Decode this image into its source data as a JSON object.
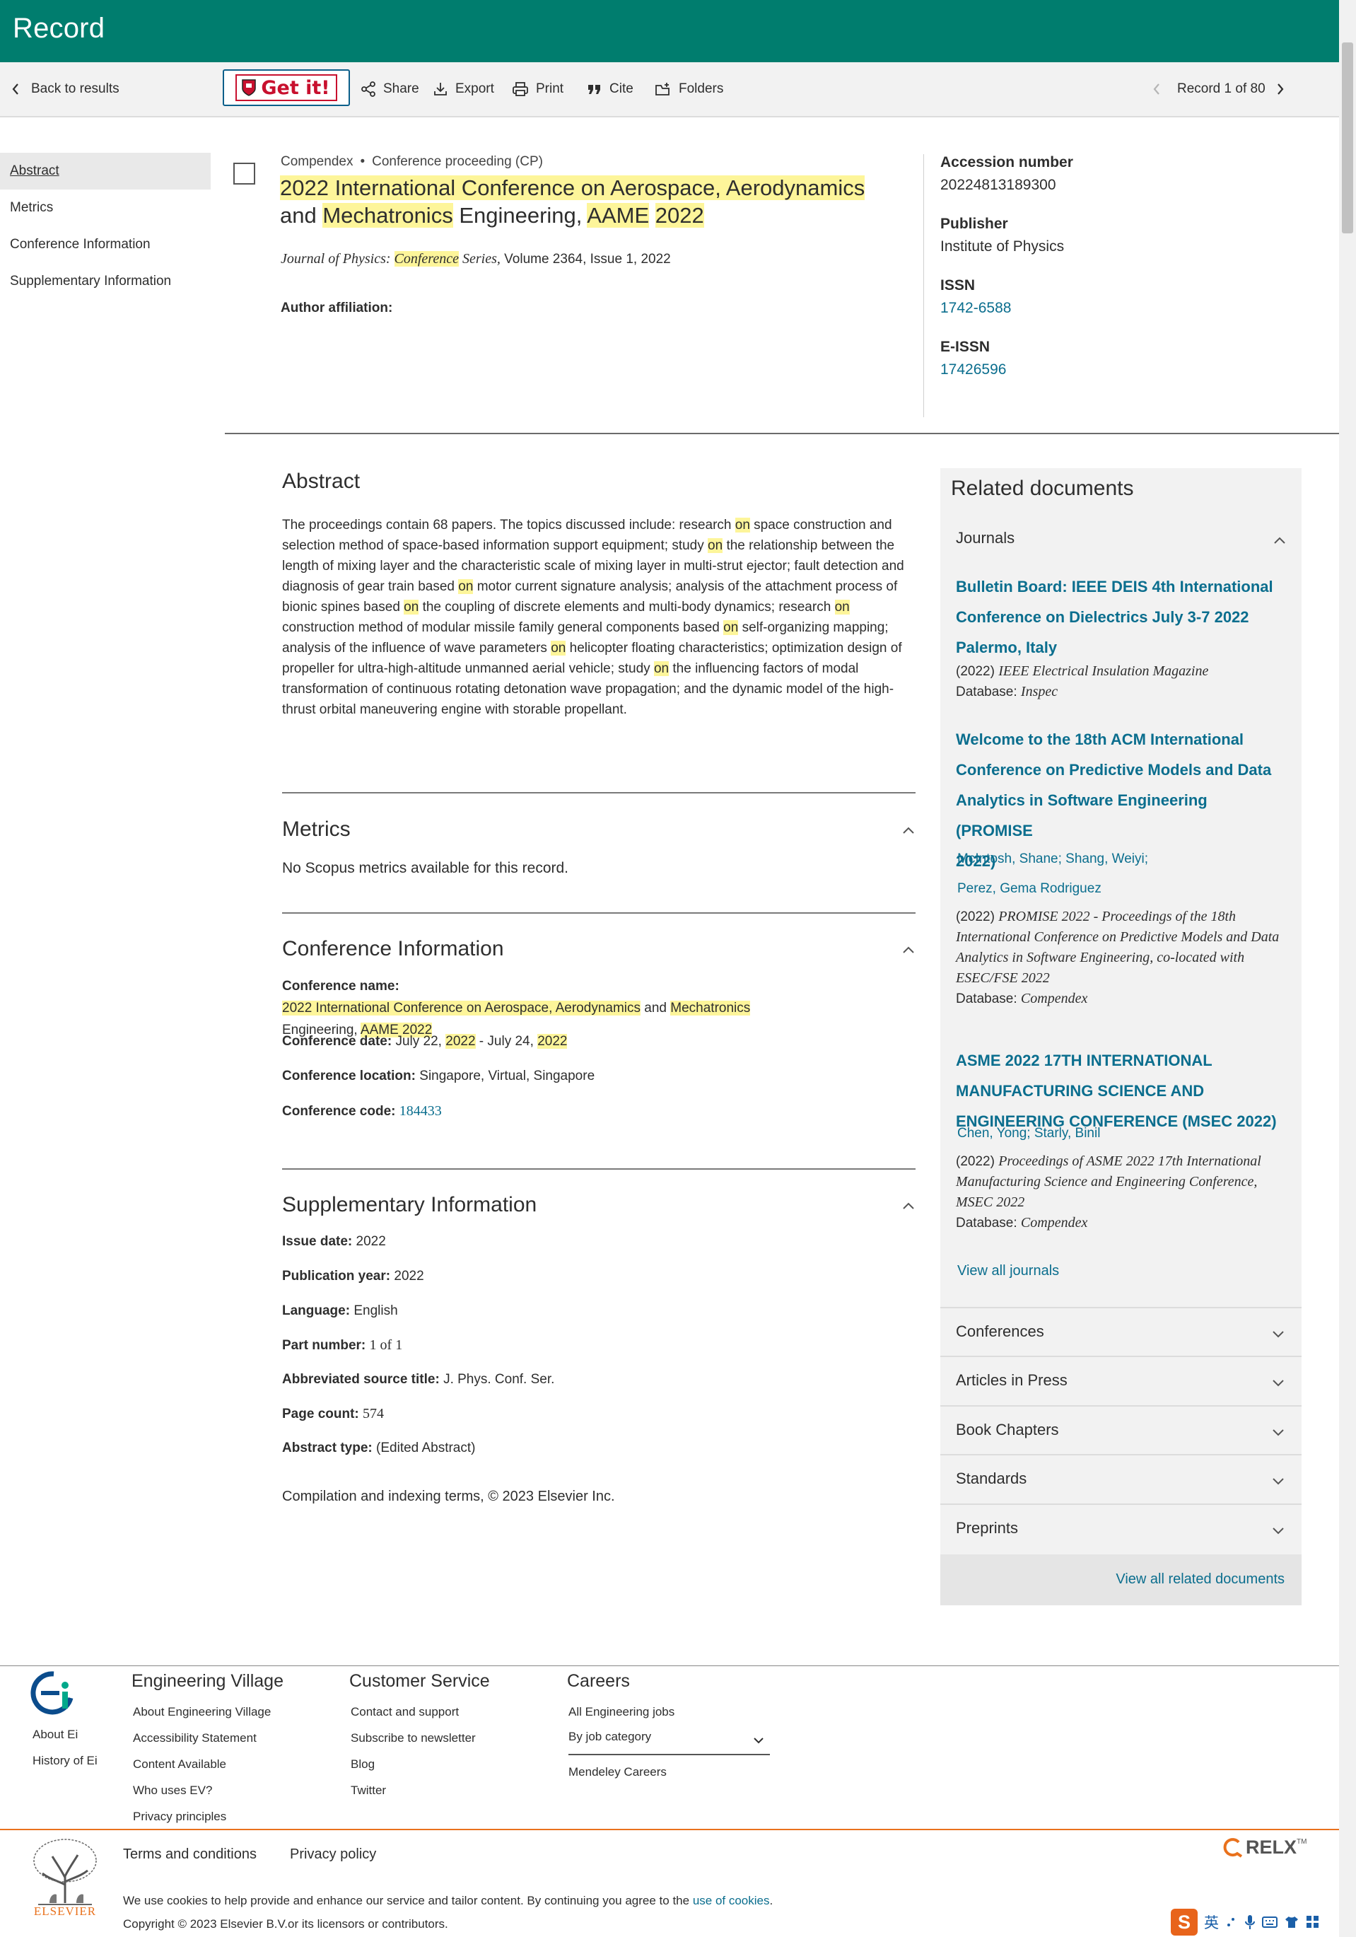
{
  "header": {
    "title": "Record"
  },
  "toolbar": {
    "back": "Back to results",
    "getit": "Get it!",
    "share": "Share",
    "export": "Export",
    "print": "Print",
    "cite": "Cite",
    "folders": "Folders",
    "record_counter": "Record 1 of 80"
  },
  "nav": {
    "items": [
      "Abstract",
      "Metrics",
      "Conference Information",
      "Supplementary Information"
    ]
  },
  "record": {
    "database": "Compendex",
    "doc_type": "Conference proceeding (CP)",
    "title_parts": {
      "p1": "2022 International Conference on Aerospace, Aerodynamics",
      "p2": " and ",
      "p3": "Mechatronics",
      "p4": " Engineering, ",
      "p5": "AAME",
      "p6": " ",
      "p7": "2022"
    },
    "source_journal": "Journal of Physics: ",
    "source_hl": "Conference",
    "source_series": " Series,",
    "source_rest": " Volume 2364, Issue 1, 2022",
    "author_affiliation_label": "Author affiliation:"
  },
  "side_info": {
    "accession_label": "Accession number",
    "accession_value": "20224813189300",
    "publisher_label": "Publisher",
    "publisher_value": "Institute of Physics",
    "issn_label": "ISSN",
    "issn_value": "1742-6588",
    "eissn_label": "E-ISSN",
    "eissn_value": "17426596"
  },
  "abstract": {
    "heading": "Abstract",
    "segments": [
      "The proceedings contain 68 papers. The topics discussed include: research ",
      "on",
      " space construction and selection method of space-based information support equipment; study ",
      "on",
      " the relationship between the length of mixing layer and the characteristic scale of mixing layer in multi-strut ejector; fault detection and diagnosis of gear train based ",
      "on",
      " motor current signature analysis; analysis of the attachment process of bionic spines based ",
      "on",
      " the coupling of discrete elements and multi-body dynamics; research ",
      "on",
      " construction method of modular missile family general components based ",
      "on",
      " self-organizing mapping; analysis of the influence of wave parameters ",
      "on",
      " helicopter floating characteristics; optimization design of propeller for ultra-high-altitude unmanned aerial vehicle; study ",
      "on",
      " the influencing factors of modal transformation of continuous rotating detonation wave propagation; and the dynamic model of the high-thrust orbital maneuvering engine with storable propellant."
    ]
  },
  "metrics": {
    "heading": "Metrics",
    "text": "No Scopus metrics available for this record."
  },
  "conference": {
    "heading": "Conference Information",
    "name_label": "Conference name:",
    "name_parts": [
      "2022 International Conference on Aerospace, Aerodynamics",
      " and ",
      "Mechatronics",
      " Engineering, ",
      "AAME 2022"
    ],
    "date_label": "Conference date:",
    "date_parts": [
      "July 22, ",
      "2022",
      " - July 24, ",
      "2022"
    ],
    "location_label": "Conference location:",
    "location_value": "Singapore, Virtual, Singapore",
    "code_label": "Conference code:",
    "code_value": "184433"
  },
  "supplementary": {
    "heading": "Supplementary Information",
    "rows": [
      {
        "label": "Issue date:",
        "value": "2022"
      },
      {
        "label": "Publication year:",
        "value": "2022"
      },
      {
        "label": "Language:",
        "value": "English"
      },
      {
        "label": "Part number:",
        "value": "1 of 1"
      },
      {
        "label": "Abbreviated source title:",
        "value": "J. Phys. Conf. Ser."
      },
      {
        "label": "Page count:",
        "value": "574"
      },
      {
        "label": "Abstract type:",
        "value": "(Edited Abstract)"
      }
    ],
    "copyright": "Compilation and indexing terms, © 2023 Elsevier Inc."
  },
  "related": {
    "heading": "Related documents",
    "journals_label": "Journals",
    "docs": [
      {
        "title": [
          "Bulletin Board: IEEE DEIS 4th International",
          "Conference on Dielectrics July 3-7 2022",
          "Palermo, Italy"
        ],
        "authors": [],
        "source_year": "(2022) ",
        "source_title": [
          "IEEE Electrical Insulation Magazine"
        ],
        "db_label": "Database: ",
        "db": "Inspec"
      },
      {
        "title": [
          "Welcome to the 18th ACM International",
          "Conference on Predictive Models and Data",
          "Analytics in Software Engineering (PROMISE",
          "2022)"
        ],
        "authors": [
          "McIntosh, Shane; Shang, Weiyi;",
          "Perez, Gema Rodriguez"
        ],
        "source_year": "(2022) ",
        "source_title": [
          "PROMISE 2022 - Proceedings of the 18th",
          "International Conference on Predictive Models and Data",
          "Analytics in Software Engineering, co-located with",
          "ESEC/FSE 2022"
        ],
        "db_label": "Database: ",
        "db": "Compendex"
      },
      {
        "title": [
          "ASME 2022 17TH INTERNATIONAL",
          "MANUFACTURING SCIENCE AND",
          "ENGINEERING CONFERENCE (MSEC 2022)"
        ],
        "authors": [
          "Chen, Yong; Starly, Binil"
        ],
        "source_year": "(2022) ",
        "source_title": [
          "Proceedings of ASME 2022 17th International",
          "Manufacturing Science and Engineering Conference,",
          "MSEC 2022"
        ],
        "db_label": "Database: ",
        "db": "Compendex"
      }
    ],
    "view_all_journals": "View all journals",
    "categories": [
      "Conferences",
      "Articles in Press",
      "Book Chapters",
      "Standards",
      "Preprints"
    ],
    "view_all_related": "View all related documents"
  },
  "footer": {
    "about": "About Ei",
    "history": "History of Ei",
    "col1_title": "Engineering Village",
    "col1_links": [
      "About Engineering Village",
      "Accessibility Statement",
      "Content Available",
      "Who uses EV?",
      "Privacy principles"
    ],
    "col2_title": "Customer Service",
    "col2_links": [
      "Contact and support",
      "Subscribe to newsletter",
      "Blog",
      "Twitter"
    ],
    "col3_title": "Careers",
    "col3_links": [
      "All Engineering jobs"
    ],
    "job_select": "By job category",
    "mendeley": "Mendeley Careers",
    "terms": "Terms and conditions",
    "privacy": "Privacy policy",
    "cookies_text": "We use cookies to help provide and enhance our service and tailor content. By continuing you agree to the ",
    "cookies_link": "use of cookies",
    "cookies_end": ".",
    "copyright": "Copyright © 2023 Elsevier B.V.or its licensors or contributors.",
    "elsevier": "ELSEVIER",
    "relx": "RELX",
    "relx_tm": "TM",
    "ime_lang": "英"
  },
  "colors": {
    "header": "#007d6e",
    "link": "#0b6e8e",
    "highlight": "#fdf59a",
    "footer_rule": "#e9711c"
  }
}
